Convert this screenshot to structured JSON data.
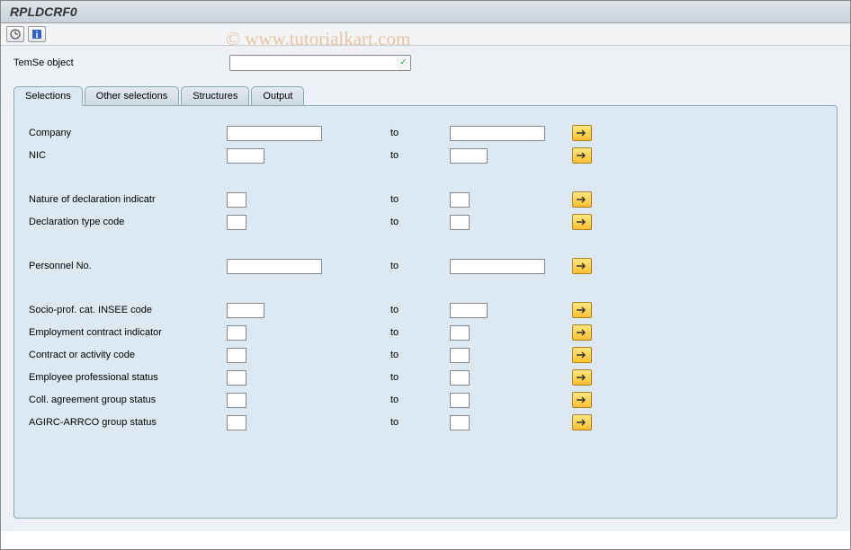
{
  "title": "RPLDCRF0",
  "watermark": "© www.tutorialkart.com",
  "temse": {
    "label": "TemSe object",
    "value": ""
  },
  "tabs": [
    "Selections",
    "Other selections",
    "Structures",
    "Output"
  ],
  "active_tab": "Selections",
  "to_label": "to",
  "fields": {
    "company": "Company",
    "nic": "NIC",
    "nature": "Nature of declaration indicatr",
    "decl_type": "Declaration type code",
    "personnel": "Personnel No.",
    "socio": "Socio-prof. cat. INSEE code",
    "emp_contract": "Employment contract indicator",
    "contract_activity": "Contract or activity code",
    "emp_prof_status": "Employee professional status",
    "coll_agreement": "Coll. agreement group status",
    "agirc": "AGIRC-ARRCO group status"
  }
}
